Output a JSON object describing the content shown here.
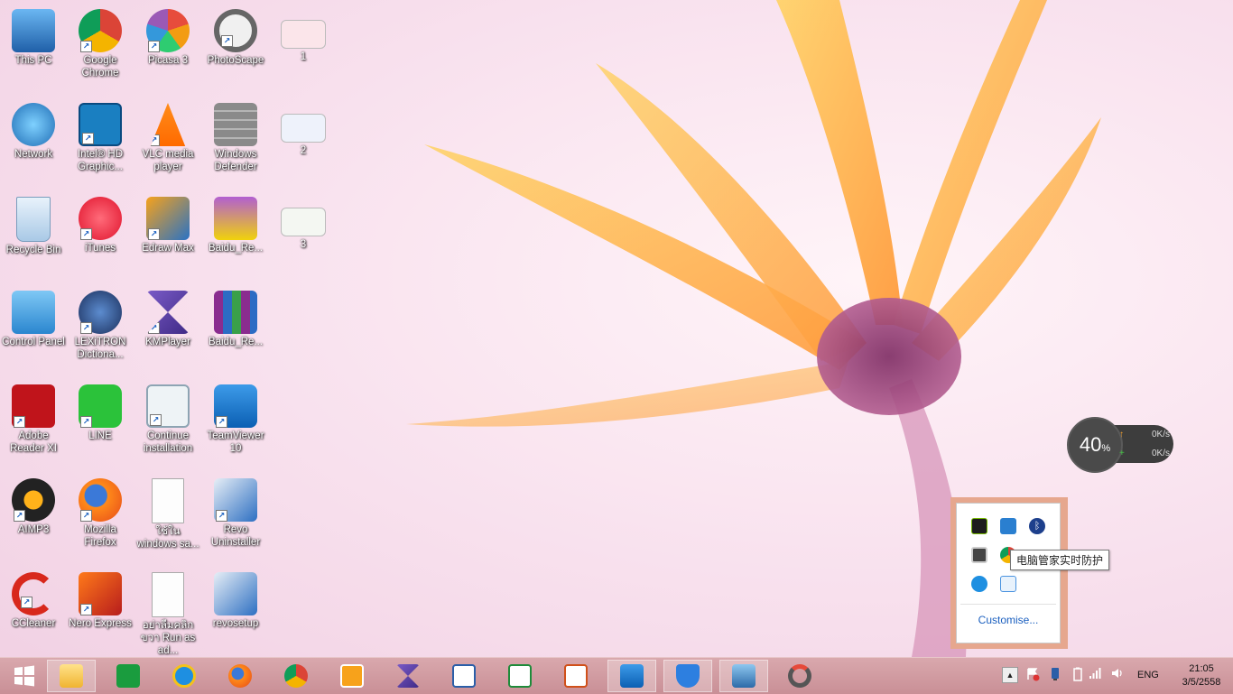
{
  "desktop": {
    "icons": [
      {
        "label": "This PC"
      },
      {
        "label": "Google Chrome"
      },
      {
        "label": "Picasa 3"
      },
      {
        "label": "PhotoScape"
      },
      {
        "label": "1"
      },
      {
        "label": "Network"
      },
      {
        "label": "Intel® HD Graphic..."
      },
      {
        "label": "VLC media player"
      },
      {
        "label": "Windows Defender"
      },
      {
        "label": "2"
      },
      {
        "label": "Recycle Bin"
      },
      {
        "label": "iTunes"
      },
      {
        "label": "Edraw Max"
      },
      {
        "label": "Baidu_Re..."
      },
      {
        "label": "3"
      },
      {
        "label": "Control Panel"
      },
      {
        "label": "LEXiTRON Dictiona..."
      },
      {
        "label": "KMPlayer"
      },
      {
        "label": "Baidu_Re..."
      },
      {
        "label": "Adobe Reader XI"
      },
      {
        "label": "LINE"
      },
      {
        "label": "Continue installation"
      },
      {
        "label": "TeamViewer 10"
      },
      {
        "label": "AIMP3"
      },
      {
        "label": "Mozilla Firefox"
      },
      {
        "label": "ใช้ใน windows sa..."
      },
      {
        "label": "Revo Uninstaller"
      },
      {
        "label": "CCleaner"
      },
      {
        "label": "Nero Express"
      },
      {
        "label": "อย่าลืมคลิกขวา Run as ad..."
      },
      {
        "label": "revosetup"
      }
    ],
    "shortcut_arrow": "↗"
  },
  "netwidget": {
    "percent": "40",
    "percent_unit": "%",
    "upload": "0K/s",
    "download": "0K/s",
    "up_arrow": "↑",
    "down_arrow": "+"
  },
  "tray_popup": {
    "tooltip": "电脑管家实时防护",
    "customise": "Customise..."
  },
  "taskbar": {
    "start_icon": "windows-logo",
    "apps": [
      "file-explorer",
      "store",
      "internet-explorer",
      "firefox",
      "chrome",
      "media-player",
      "kmplayer",
      "libreoffice-writer",
      "libreoffice-calc",
      "libreoffice-impress",
      "teamviewer",
      "tencent-pc-manager",
      "network-tool",
      "photoscape"
    ],
    "tray_arrow": "▲",
    "language": "ENG",
    "time": "21:05",
    "date": "3/5/2558"
  }
}
